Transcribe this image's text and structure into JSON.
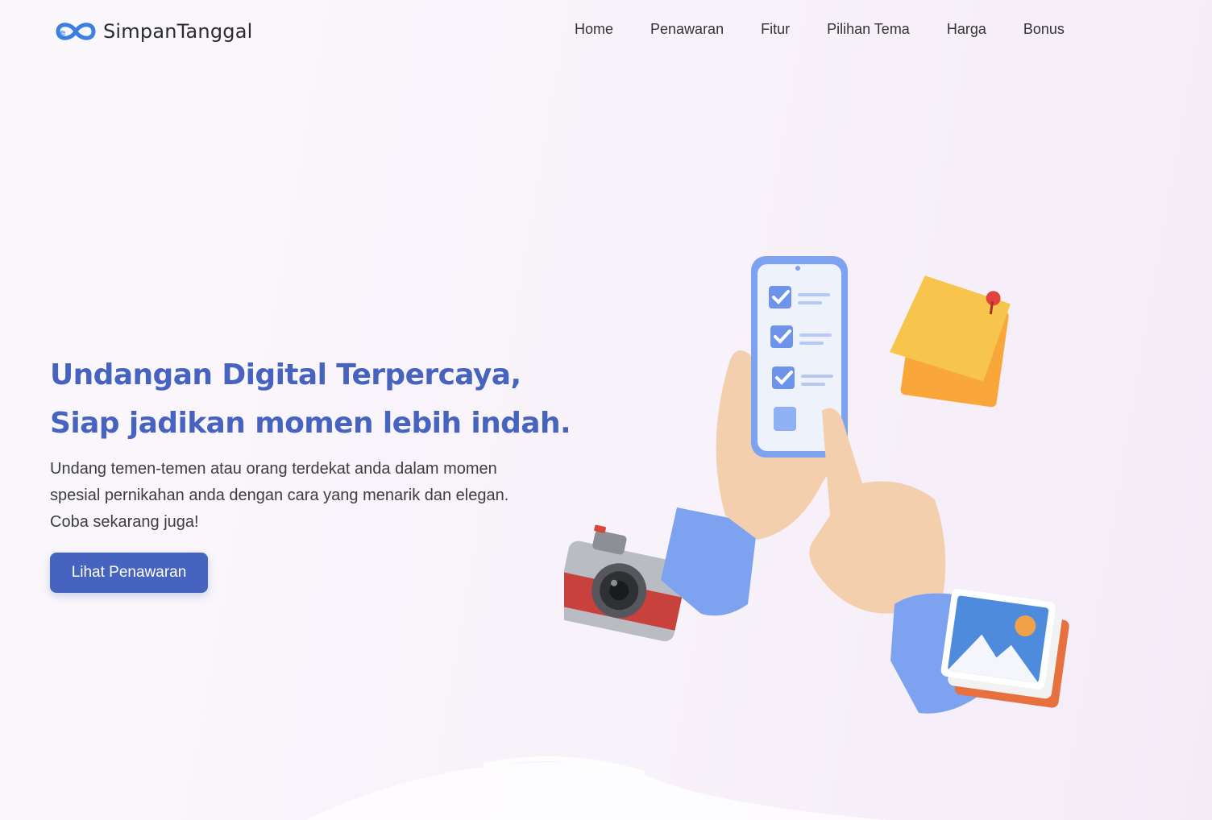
{
  "brand": {
    "name": "SimpanTanggal",
    "logo_icon": "infinity-logo-icon"
  },
  "nav": {
    "items": [
      {
        "label": "Home"
      },
      {
        "label": "Penawaran"
      },
      {
        "label": "Fitur"
      },
      {
        "label": "Pilihan Tema"
      },
      {
        "label": "Harga"
      },
      {
        "label": "Bonus"
      }
    ]
  },
  "hero": {
    "title_line1": "Undangan Digital Terpercaya,",
    "title_line2": "Siap jadikan momen lebih indah.",
    "description": "Undang temen-temen atau orang terdekat anda dalam momen spesial pernikahan anda dengan cara yang menarik dan elegan. Coba sekarang juga!",
    "cta_label": "Lihat Penawaran"
  },
  "illustration": {
    "icons": [
      "hand-phone-checklist-icon",
      "sticky-note-icon",
      "camera-icon",
      "photo-gallery-icon",
      "pointing-hand-icon"
    ]
  },
  "colors": {
    "accent": "#4663c0",
    "background": "#f8f2fa",
    "text": "#3d3d3d"
  }
}
